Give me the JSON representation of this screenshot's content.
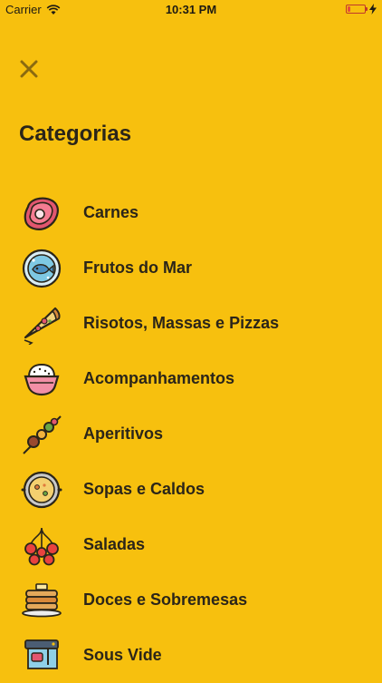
{
  "status": {
    "carrier": "Carrier",
    "time": "10:31 PM",
    "battery_level": 0.15
  },
  "header": {
    "title": "Categorias"
  },
  "categories": [
    {
      "label": "Carnes",
      "icon": "steak-icon"
    },
    {
      "label": "Frutos do Mar",
      "icon": "fish-plate-icon"
    },
    {
      "label": "Risotos, Massas e Pizzas",
      "icon": "pizza-slice-icon"
    },
    {
      "label": "Acompanhamentos",
      "icon": "rice-bowl-icon"
    },
    {
      "label": "Aperitivos",
      "icon": "skewer-icon"
    },
    {
      "label": "Sopas e Caldos",
      "icon": "soup-pot-icon"
    },
    {
      "label": "Saladas",
      "icon": "tomatoes-icon"
    },
    {
      "label": "Doces e Sobremesas",
      "icon": "pancakes-icon"
    },
    {
      "label": "Sous Vide",
      "icon": "sous-vide-icon"
    }
  ],
  "colors": {
    "background": "#F7C00E",
    "text": "#2B2519"
  }
}
